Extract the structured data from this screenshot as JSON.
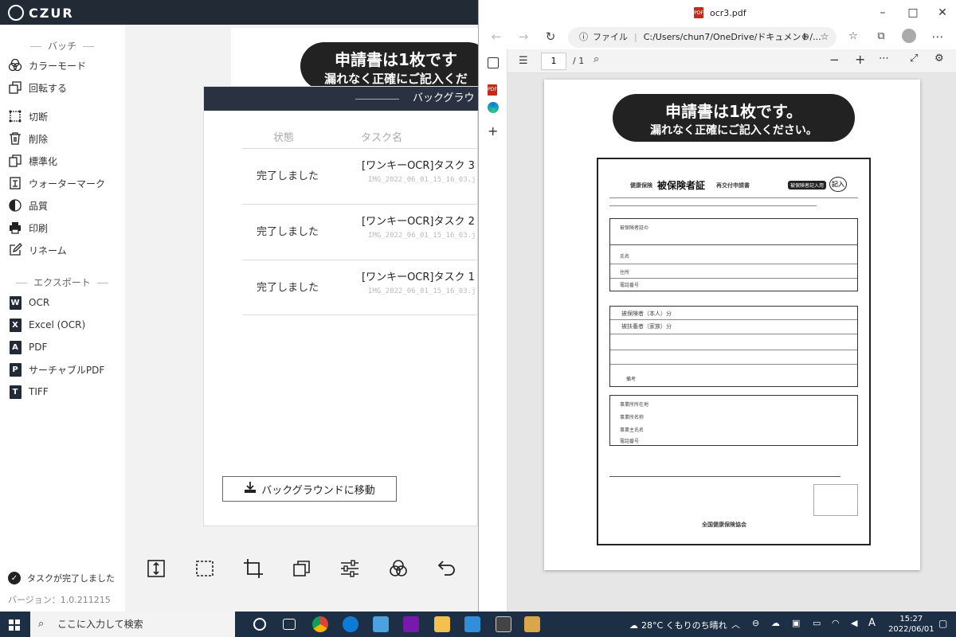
{
  "czur": {
    "app_name": "CZUR",
    "batch_section": "バッチ",
    "batch_items": [
      "カラーモード",
      "回転する",
      "切断",
      "削除",
      "標準化",
      "ウォーターマーク",
      "品質",
      "印刷",
      "リネーム"
    ],
    "export_section": "エクスポート",
    "export_items": [
      "OCR",
      "Excel (OCR)",
      "PDF",
      "サーチャブルPDF",
      "TIFF"
    ],
    "status": "タスクが完了しました",
    "version": "バージョン：1.0.211215",
    "preview_banner_line1": "申請書は1枚です",
    "preview_banner_line2": "漏れなく正確にご記入くだ",
    "dialog": {
      "title": "バックグラウ",
      "col_status": "状態",
      "col_task": "タスク名",
      "rows": [
        {
          "status": "完了しました",
          "name": "[ワンキーOCR]タスク 3",
          "file": "IMG_2022_06_01_15_16_03.j"
        },
        {
          "status": "完了しました",
          "name": "[ワンキーOCR]タスク 2",
          "file": "IMG_2022_06_01_15_16_03.j"
        },
        {
          "status": "完了しました",
          "name": "[ワンキーOCR]タスク 1",
          "file": "IMG_2022_06_01_15_16_03.j"
        }
      ],
      "move_button": "バックグラウンドに移動"
    }
  },
  "edge": {
    "tab_title": "ocr3.pdf",
    "address_label": "ファイル",
    "address": "C:/Users/chun7/OneDrive/ドキュメント/...",
    "page_current": "1",
    "page_total": "/ 1",
    "doc": {
      "banner_line1": "申請書は1枚です。",
      "banner_line2": "漏れなく正確にご記入ください。",
      "form_title": "被保険者証",
      "form_prefix": "健康保険",
      "form_suffix": "再交付申請書",
      "badge": "被保険者記入用",
      "stamp": "記入",
      "labels": [
        "被保険者証の",
        "氏名",
        "住所",
        "電話番号",
        "被保険者（本人）分",
        "被扶養者（家族）分",
        "備考",
        "事業所所在地",
        "事業所名称",
        "事業主氏名",
        "電話番号",
        "全国健康保険協会"
      ]
    }
  },
  "taskbar": {
    "search_placeholder": "ここに入力して検索",
    "weather": "28°C くもりのち晴れ",
    "ime": "A",
    "time": "15:27",
    "date": "2022/06/01"
  }
}
